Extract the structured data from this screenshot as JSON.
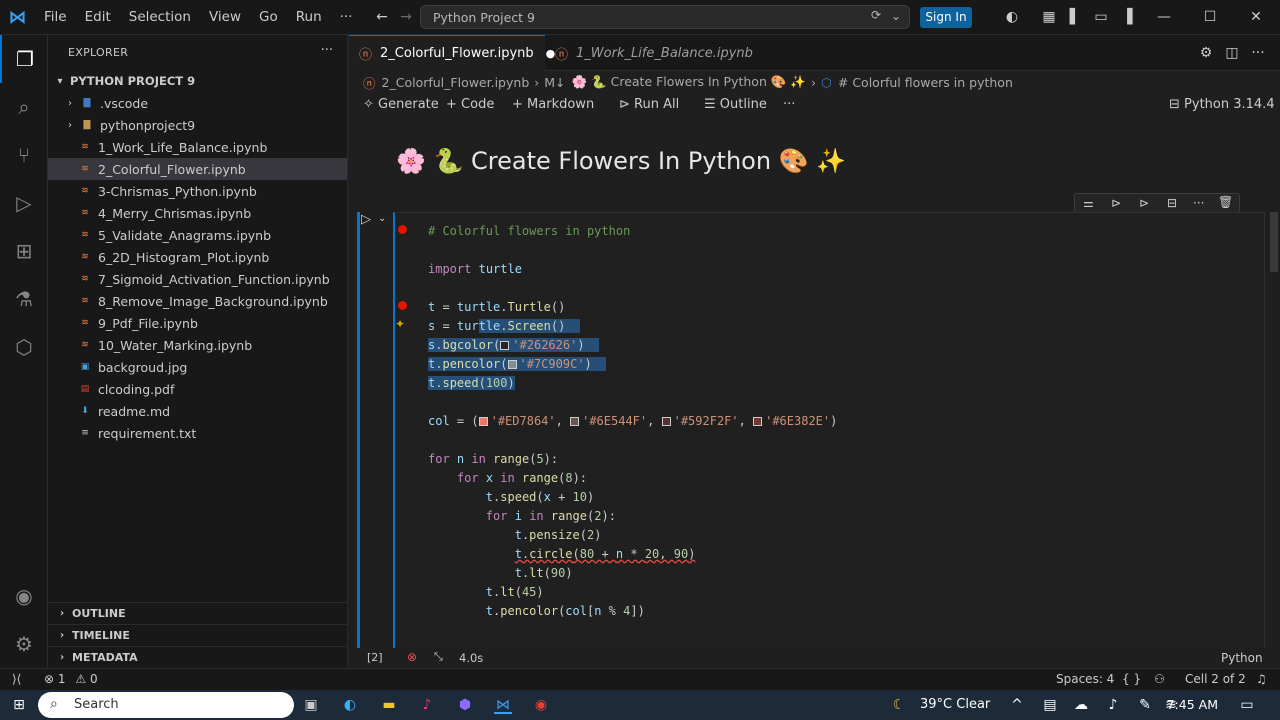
{
  "menu": [
    "File",
    "Edit",
    "Selection",
    "View",
    "Go",
    "Run",
    "···"
  ],
  "command_center": "Python Project 9",
  "signin_label": "Sign In",
  "explorer": {
    "title": "EXPLORER",
    "project": "PYTHON PROJECT 9",
    "items": [
      {
        "label": ".vscode",
        "type": "folder"
      },
      {
        "label": "pythonproject9",
        "type": "folder"
      },
      {
        "label": "1_Work_Life_Balance.ipynb",
        "type": "notebook"
      },
      {
        "label": "2_Colorful_Flower.ipynb",
        "type": "notebook"
      },
      {
        "label": "3-Chrismas_Python.ipynb",
        "type": "notebook"
      },
      {
        "label": "4_Merry_Chrismas.ipynb",
        "type": "notebook"
      },
      {
        "label": "5_Validate_Anagrams.ipynb",
        "type": "notebook"
      },
      {
        "label": "6_2D_Histogram_Plot.ipynb",
        "type": "notebook"
      },
      {
        "label": "7_Sigmoid_Activation_Function.ipynb",
        "type": "notebook"
      },
      {
        "label": "8_Remove_Image_Background.ipynb",
        "type": "notebook"
      },
      {
        "label": "9_Pdf_File.ipynb",
        "type": "notebook"
      },
      {
        "label": "10_Water_Marking.ipynb",
        "type": "notebook"
      },
      {
        "label": "backgroud.jpg",
        "type": "image"
      },
      {
        "label": "clcoding.pdf",
        "type": "pdf"
      },
      {
        "label": "readme.md",
        "type": "markdown"
      },
      {
        "label": "requirement.txt",
        "type": "text"
      }
    ],
    "sections": [
      "OUTLINE",
      "TIMELINE",
      "METADATA"
    ]
  },
  "tabs": [
    {
      "label": "2_Colorful_Flower.ipynb",
      "dirty": "●"
    },
    {
      "label": "1_Work_Life_Balance.ipynb"
    }
  ],
  "breadcrumb": {
    "file": "2_Colorful_Flower.ipynb",
    "md": "M↓",
    "heading": "🌸 🐍 Create Flowers In Python 🎨 ✨",
    "cell": "# Colorful flowers in python"
  },
  "toolbar": {
    "generate": "Generate",
    "code": "Code",
    "markdown": "Markdown",
    "run_all": "Run All",
    "outline": "Outline",
    "more": "···",
    "kernel": "Python 3.14.4"
  },
  "markdown_title": "🌸 🐍 Create Flowers In Python 🎨 ✨",
  "cell": {
    "exec_count": "[2]",
    "time": "4.0s",
    "language": "Python"
  },
  "colors": {
    "bg": "#262626",
    "pen": "#7C909C",
    "c1": "#ED7864",
    "c2": "#6E544F",
    "c3": "#592F2F",
    "c4": "#6E382E"
  },
  "status": {
    "errors": "1",
    "warnings": "0",
    "spaces": "Spaces: 4",
    "braces": "{ }",
    "cell": "Cell 2 of 2"
  },
  "taskbar": {
    "search": "Search",
    "weather": "39°C  Clear",
    "time": "7:45 AM"
  }
}
